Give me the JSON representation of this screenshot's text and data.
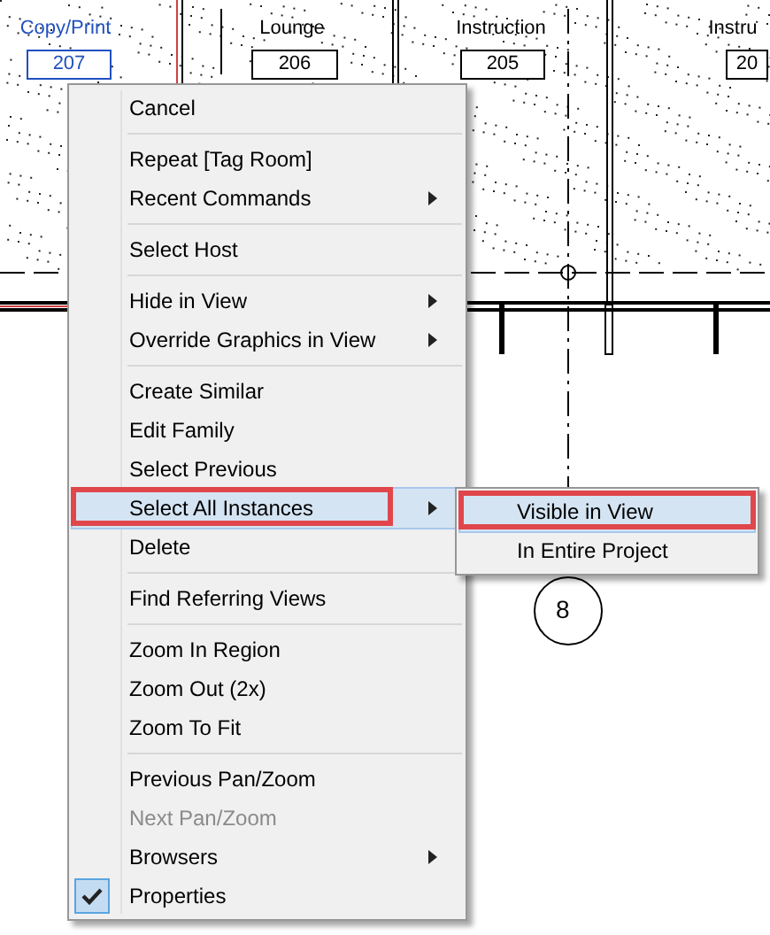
{
  "drawing": {
    "rooms": [
      {
        "name": "Copy/Print",
        "number": "207",
        "selected": true
      },
      {
        "name": "Lounge",
        "number": "206",
        "selected": false
      },
      {
        "name": "Instruction",
        "number": "205",
        "selected": false
      },
      {
        "name": "Instru",
        "number": "20",
        "selected": false
      }
    ],
    "grid_bubble": "8"
  },
  "context_menu": {
    "groups": [
      {
        "items": [
          {
            "label": "Cancel",
            "has_submenu": false,
            "selected": false,
            "callout": false,
            "disabled": false,
            "checked": false
          }
        ]
      },
      {
        "items": [
          {
            "label": "Repeat [Tag Room]",
            "has_submenu": false,
            "selected": false,
            "callout": false,
            "disabled": false,
            "checked": false
          },
          {
            "label": "Recent Commands",
            "has_submenu": true,
            "selected": false,
            "callout": false,
            "disabled": false,
            "checked": false
          }
        ]
      },
      {
        "items": [
          {
            "label": "Select Host",
            "has_submenu": false,
            "selected": false,
            "callout": false,
            "disabled": false,
            "checked": false
          }
        ]
      },
      {
        "items": [
          {
            "label": "Hide in View",
            "has_submenu": true,
            "selected": false,
            "callout": false,
            "disabled": false,
            "checked": false
          },
          {
            "label": "Override Graphics in View",
            "has_submenu": true,
            "selected": false,
            "callout": false,
            "disabled": false,
            "checked": false
          }
        ]
      },
      {
        "items": [
          {
            "label": "Create Similar",
            "has_submenu": false,
            "selected": false,
            "callout": false,
            "disabled": false,
            "checked": false
          },
          {
            "label": "Edit Family",
            "has_submenu": false,
            "selected": false,
            "callout": false,
            "disabled": false,
            "checked": false
          },
          {
            "label": "Select Previous",
            "has_submenu": false,
            "selected": false,
            "callout": false,
            "disabled": false,
            "checked": false
          },
          {
            "label": "Select All Instances",
            "has_submenu": true,
            "selected": true,
            "callout": true,
            "disabled": false,
            "checked": false
          },
          {
            "label": "Delete",
            "has_submenu": false,
            "selected": false,
            "callout": false,
            "disabled": false,
            "checked": false
          }
        ]
      },
      {
        "items": [
          {
            "label": "Find Referring Views",
            "has_submenu": false,
            "selected": false,
            "callout": false,
            "disabled": false,
            "checked": false
          }
        ]
      },
      {
        "items": [
          {
            "label": "Zoom In Region",
            "has_submenu": false,
            "selected": false,
            "callout": false,
            "disabled": false,
            "checked": false
          },
          {
            "label": "Zoom Out (2x)",
            "has_submenu": false,
            "selected": false,
            "callout": false,
            "disabled": false,
            "checked": false
          },
          {
            "label": "Zoom To Fit",
            "has_submenu": false,
            "selected": false,
            "callout": false,
            "disabled": false,
            "checked": false
          }
        ]
      },
      {
        "items": [
          {
            "label": "Previous Pan/Zoom",
            "has_submenu": false,
            "selected": false,
            "callout": false,
            "disabled": false,
            "checked": false
          },
          {
            "label": "Next Pan/Zoom",
            "has_submenu": false,
            "selected": false,
            "callout": false,
            "disabled": true,
            "checked": false
          },
          {
            "label": "Browsers",
            "has_submenu": true,
            "selected": false,
            "callout": false,
            "disabled": false,
            "checked": false
          },
          {
            "label": "Properties",
            "has_submenu": false,
            "selected": false,
            "callout": false,
            "disabled": false,
            "checked": true
          }
        ]
      }
    ]
  },
  "submenu": {
    "items": [
      {
        "label": "Visible in View",
        "selected": true,
        "callout": true
      },
      {
        "label": "In Entire Project",
        "selected": false,
        "callout": false
      }
    ]
  }
}
